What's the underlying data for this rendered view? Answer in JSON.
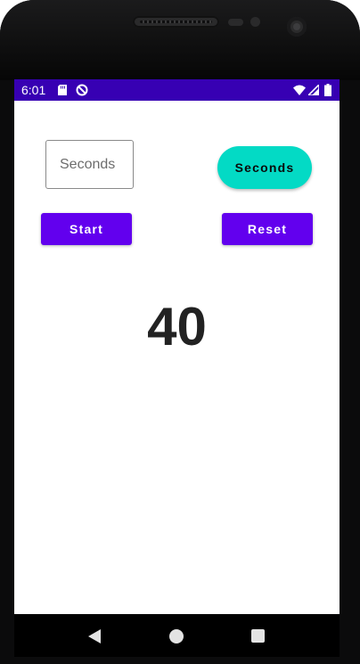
{
  "status_bar": {
    "time": "6:01",
    "background_color": "#3700b3",
    "icons": [
      "sd-card-icon",
      "data-saver-icon",
      "wifi-icon",
      "cell-signal-icon",
      "battery-icon"
    ]
  },
  "form": {
    "seconds_input": {
      "value": "",
      "placeholder": "Seconds"
    },
    "seconds_button_label": "Seconds",
    "start_button_label": "Start",
    "reset_button_label": "Reset"
  },
  "timer": {
    "value": "40"
  },
  "navigation": {
    "icons": [
      "back-icon",
      "home-icon",
      "recents-icon"
    ]
  },
  "colors": {
    "primary": "#6200ee",
    "secondary": "#03dac5",
    "status_bar": "#3700b3",
    "text": "#222222"
  }
}
